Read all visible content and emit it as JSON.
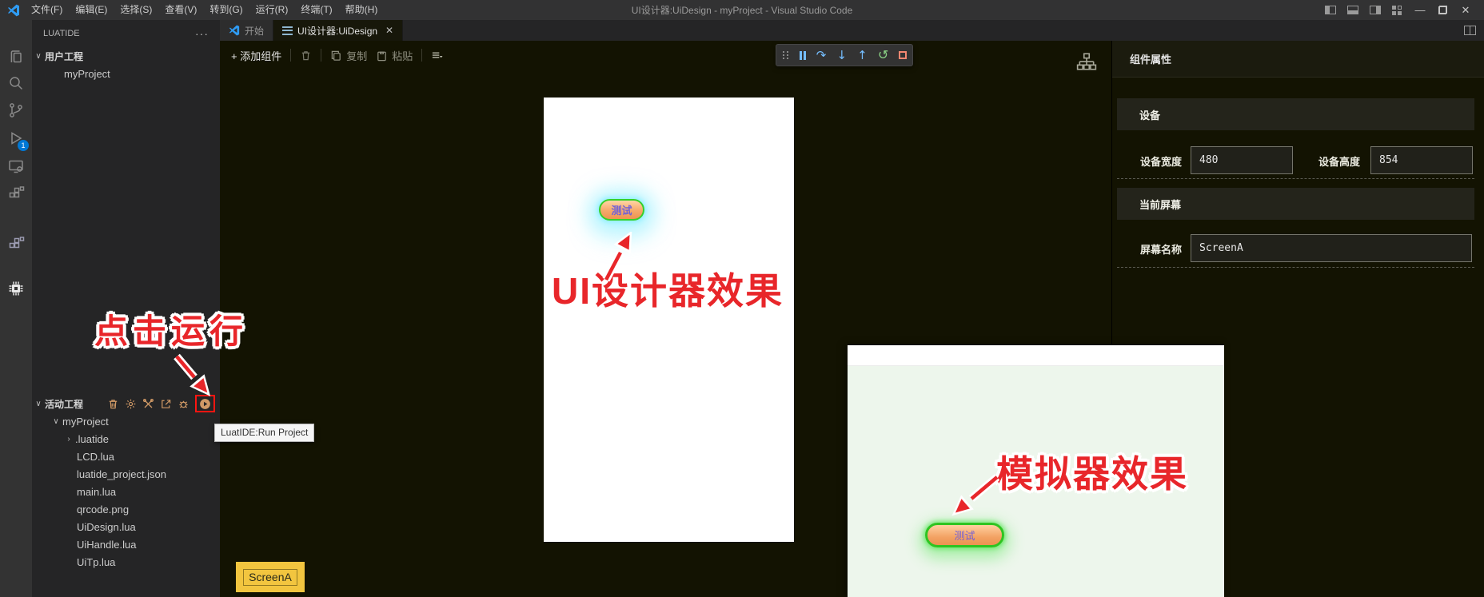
{
  "titlebar": {
    "menus": [
      "文件(F)",
      "编辑(E)",
      "选择(S)",
      "查看(V)",
      "转到(G)",
      "运行(R)",
      "终端(T)",
      "帮助(H)"
    ],
    "title": "UI设计器:UiDesign - myProject - Visual Studio Code"
  },
  "activity_bar": {
    "debug_badge": "1"
  },
  "sidebar": {
    "title": "LUATIDE",
    "more_glyph": "···",
    "user_section": "用户工程",
    "user_project": "myProject",
    "active_section": "活动工程",
    "tree": [
      "myProject",
      ".luatide",
      "LCD.lua",
      "luatide_project.json",
      "main.lua",
      "qrcode.png",
      "UiDesign.lua",
      "UiHandle.lua",
      "UiTp.lua"
    ]
  },
  "tooltip": "LuatIDE:Run Project",
  "tabs": {
    "start": "开始",
    "designer": "UI设计器:UiDesign"
  },
  "designer_toolbar": {
    "add": "+ 添加组件",
    "copy": "复制",
    "paste": "粘贴"
  },
  "debug_toolbar": {
    "step_over": "↷",
    "step_into": "↓",
    "step_out": "↑",
    "restart": "↺"
  },
  "canvas": {
    "button_label": "测试",
    "screen_tab": "ScreenA"
  },
  "props": {
    "title": "组件属性",
    "device_section": "设备",
    "device_width_label": "设备宽度",
    "device_width_value": "480",
    "device_height_label": "设备高度",
    "device_height_value": "854",
    "screen_section": "当前屏幕",
    "screen_name_label": "屏幕名称",
    "screen_name_value": "ScreenA"
  },
  "simulator": {
    "button_label": "测试"
  },
  "annotations": {
    "run": "点击运行",
    "designer": "UI设计器效果",
    "simulator": "模拟器效果"
  },
  "window_controls": {
    "minimize": "—",
    "close": "✕",
    "tab_close": "✕"
  },
  "colors": {
    "annotation_red": "#e8262a",
    "sidebar_icon_orange": "#d19a66",
    "screen_tab_yellow": "#f2c53f",
    "button_border_green": "#35d02a",
    "button_glow_cyan": "#8cf0ff",
    "badge_blue": "#0078d4",
    "debug_icon_blue": "#75beff",
    "restart_green": "#89d185",
    "stop_red": "#f48771"
  }
}
